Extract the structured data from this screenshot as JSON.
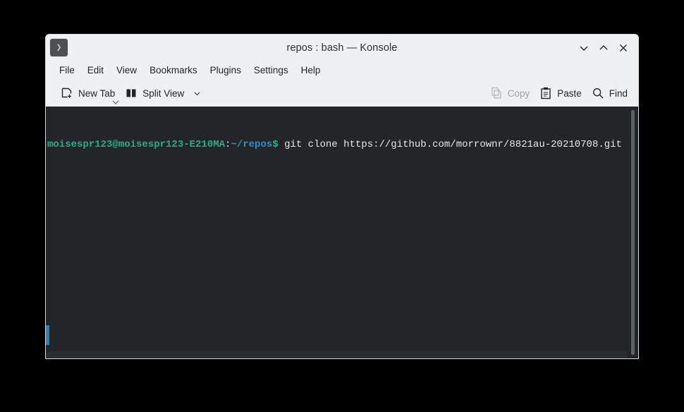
{
  "window": {
    "title": "repos : bash — Konsole",
    "icon": "terminal-prompt-icon",
    "prompt_glyph": "❯",
    "controls": [
      {
        "name": "minimize",
        "glyph": "chevron-down"
      },
      {
        "name": "maximize",
        "glyph": "chevron-up"
      },
      {
        "name": "close",
        "glyph": "x"
      }
    ]
  },
  "menubar": {
    "items": [
      {
        "label": "File"
      },
      {
        "label": "Edit"
      },
      {
        "label": "View"
      },
      {
        "label": "Bookmarks"
      },
      {
        "label": "Plugins"
      },
      {
        "label": "Settings"
      },
      {
        "label": "Help"
      }
    ]
  },
  "toolbar": {
    "new_tab": {
      "label": "New Tab",
      "icon": "new-tab-icon",
      "has_menu": true,
      "enabled": true
    },
    "split_view": {
      "label": "Split View",
      "icon": "split-view-icon",
      "has_menu": true,
      "enabled": true
    },
    "copy": {
      "label": "Copy",
      "icon": "copy-icon",
      "enabled": false
    },
    "paste": {
      "label": "Paste",
      "icon": "paste-icon",
      "enabled": true
    },
    "find": {
      "label": "Find",
      "icon": "search-icon",
      "enabled": true
    }
  },
  "terminal": {
    "prompt": {
      "user_host": "moisespr123@moisespr123-E210MA",
      "separator": ":",
      "path": "~/repos",
      "sigil": "$"
    },
    "command": " git clone https://github.com/morrownr/8821au-20210708.git ",
    "cursor": "block",
    "background": "#232629",
    "colors": {
      "user_host": "#27ae87",
      "path": "#2a91c9",
      "sigil": "#27ae87",
      "text": "#e6e7e8",
      "cursor": "#f2f3f4",
      "marker": "#2a7fbd"
    }
  }
}
